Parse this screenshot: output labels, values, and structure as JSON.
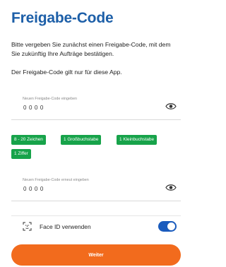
{
  "title": "Freigabe-Code",
  "intro": "Bitte vergeben Sie zunächst einen Freigabe-Code, mit dem Sie zukünftig Ihre Aufträge bestätigen.",
  "note": "Der Freigabe-Code gilt nur für diese App.",
  "field_new": {
    "label": "Neuen Freigabe-Code eingeben",
    "value": "0000",
    "icon": "eye-icon"
  },
  "requirements": [
    "8 - 20 Zeichen",
    "1 Großbuchstabe",
    "1 Kleinbuchstabe",
    "1 Ziffer"
  ],
  "field_repeat": {
    "label": "Neuen Freigabe-Code erneut eingeben",
    "value": "0000",
    "icon": "eye-icon"
  },
  "faceid": {
    "icon": "face-id-icon",
    "label": "Face ID verwenden",
    "enabled": true
  },
  "button": {
    "label": "Weiter"
  },
  "colors": {
    "title": "#1d5fa8",
    "badge": "#17a34a",
    "toggle": "#1a5bbd",
    "button": "#f26b1d"
  }
}
